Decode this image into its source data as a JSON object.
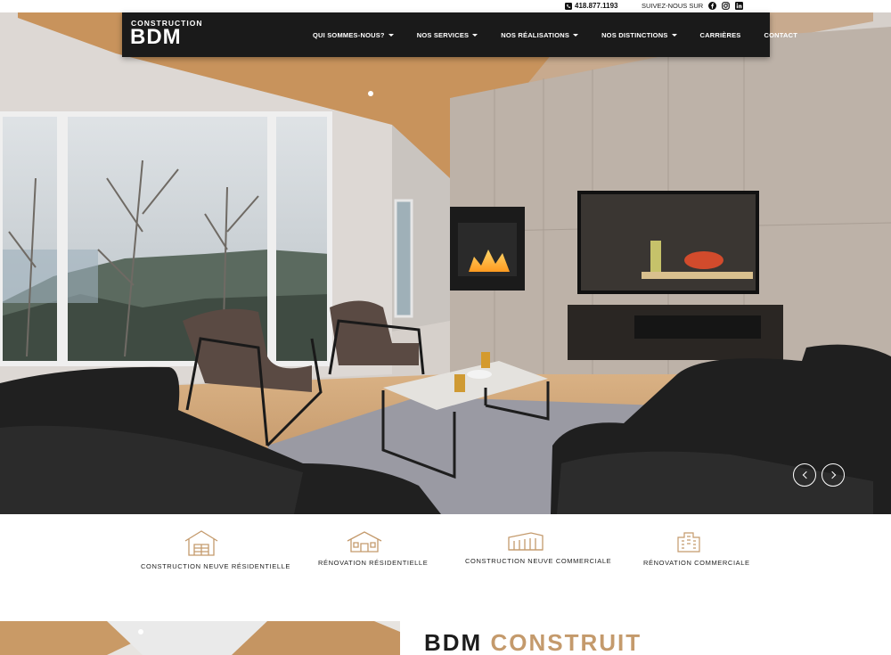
{
  "topbar": {
    "phone": "418.877.1193",
    "follow_label": "SUIVEZ-NOUS SUR",
    "social_icons": [
      "facebook-icon",
      "instagram-icon",
      "linkedin-icon"
    ]
  },
  "logo": {
    "line1": "CONSTRUCTION",
    "line2": "BDM"
  },
  "nav": {
    "items": [
      {
        "label": "QUI SOMMES-NOUS?",
        "dropdown": true
      },
      {
        "label": "NOS SERVICES",
        "dropdown": true
      },
      {
        "label": "NOS RÉALISATIONS",
        "dropdown": true
      },
      {
        "label": "NOS DISTINCTIONS",
        "dropdown": true
      },
      {
        "label": "CARRIÈRES",
        "dropdown": false
      },
      {
        "label": "CONTACT",
        "dropdown": false
      }
    ]
  },
  "slider": {
    "prev_icon": "chevron-left-icon",
    "next_icon": "chevron-right-icon"
  },
  "services": [
    {
      "label": "CONSTRUCTION NEUVE RÉSIDENTIELLE",
      "icon": "house-construction-icon"
    },
    {
      "label": "RÉNOVATION RÉSIDENTIELLE",
      "icon": "house-renovation-icon"
    },
    {
      "label": "CONSTRUCTION NEUVE COMMERCIALE",
      "icon": "commercial-building-icon"
    },
    {
      "label": "RÉNOVATION COMMERCIALE",
      "icon": "commercial-renovation-icon"
    }
  ],
  "headline": {
    "part1": "BDM",
    "part2": "CONSTRUIT"
  },
  "colors": {
    "nav_bg": "#1a1a1a",
    "accent": "#c49a6c",
    "text": "#222222"
  }
}
